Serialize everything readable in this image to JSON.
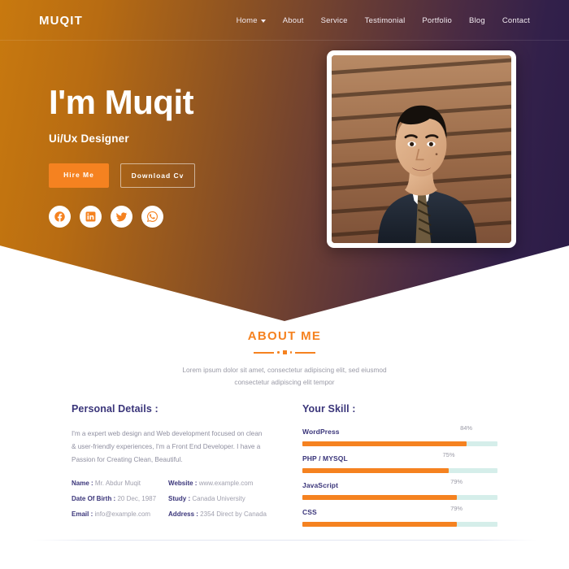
{
  "nav": {
    "logo": "MUQIT",
    "items": [
      {
        "label": "Home",
        "has_dropdown": true
      },
      {
        "label": "About",
        "has_dropdown": false
      },
      {
        "label": "Service",
        "has_dropdown": false
      },
      {
        "label": "Testimonial",
        "has_dropdown": false
      },
      {
        "label": "Portfolio",
        "has_dropdown": false
      },
      {
        "label": "Blog",
        "has_dropdown": false
      },
      {
        "label": "Contact",
        "has_dropdown": false
      }
    ]
  },
  "hero": {
    "title": "I'm Muqit",
    "subtitle": "Ui/Ux Designer",
    "primary_button": "Hire Me",
    "outline_button": "Download Cv",
    "socials": [
      {
        "name": "facebook-icon"
      },
      {
        "name": "linkedin-icon"
      },
      {
        "name": "twitter-icon"
      },
      {
        "name": "whatsapp-icon"
      }
    ],
    "photo_alt": "Portrait of man in dark suit against wooden slat wall",
    "accent_color": "#f58220",
    "gradient_start": "#c8790f",
    "gradient_end": "#2a1b47"
  },
  "about": {
    "title": "ABOUT ME",
    "description_line1": "Lorem ipsum dolor sit amet, consectetur adipiscing elit, sed eiusmod",
    "description_line2": "consectetur adipiscing elit tempor"
  },
  "personal": {
    "title": "Personal Details :",
    "paragraph": "I'm a expert web design and Web development focused on clean & user-friendly experiences, I'm a Front End Developer. I have a Passion for Creating Clean, Beautiful.",
    "left_rows": [
      {
        "key": "Name :",
        "value": "Mr. Abdur Muqit"
      },
      {
        "key": "Date Of Birth :",
        "value": "20 Dec, 1987"
      },
      {
        "key": "Email :",
        "value": "info@example.com"
      }
    ],
    "right_rows": [
      {
        "key": "Website :",
        "value": "www.example.com"
      },
      {
        "key": "Study :",
        "value": "Canada University"
      },
      {
        "key": "Address :",
        "value": "2354 Direct by Canada"
      }
    ]
  },
  "skills": {
    "title": "Your Skill :",
    "items": [
      {
        "label": "WordPress",
        "percent": "84%",
        "value": 84
      },
      {
        "label": "PHP / MYSQL",
        "percent": "75%",
        "value": 75
      },
      {
        "label": "JavaScript",
        "percent": "79%",
        "value": 79
      },
      {
        "label": "CSS",
        "percent": "79%",
        "value": 79
      }
    ],
    "bar_color": "#f58220",
    "track_color": "#d5eeea"
  }
}
